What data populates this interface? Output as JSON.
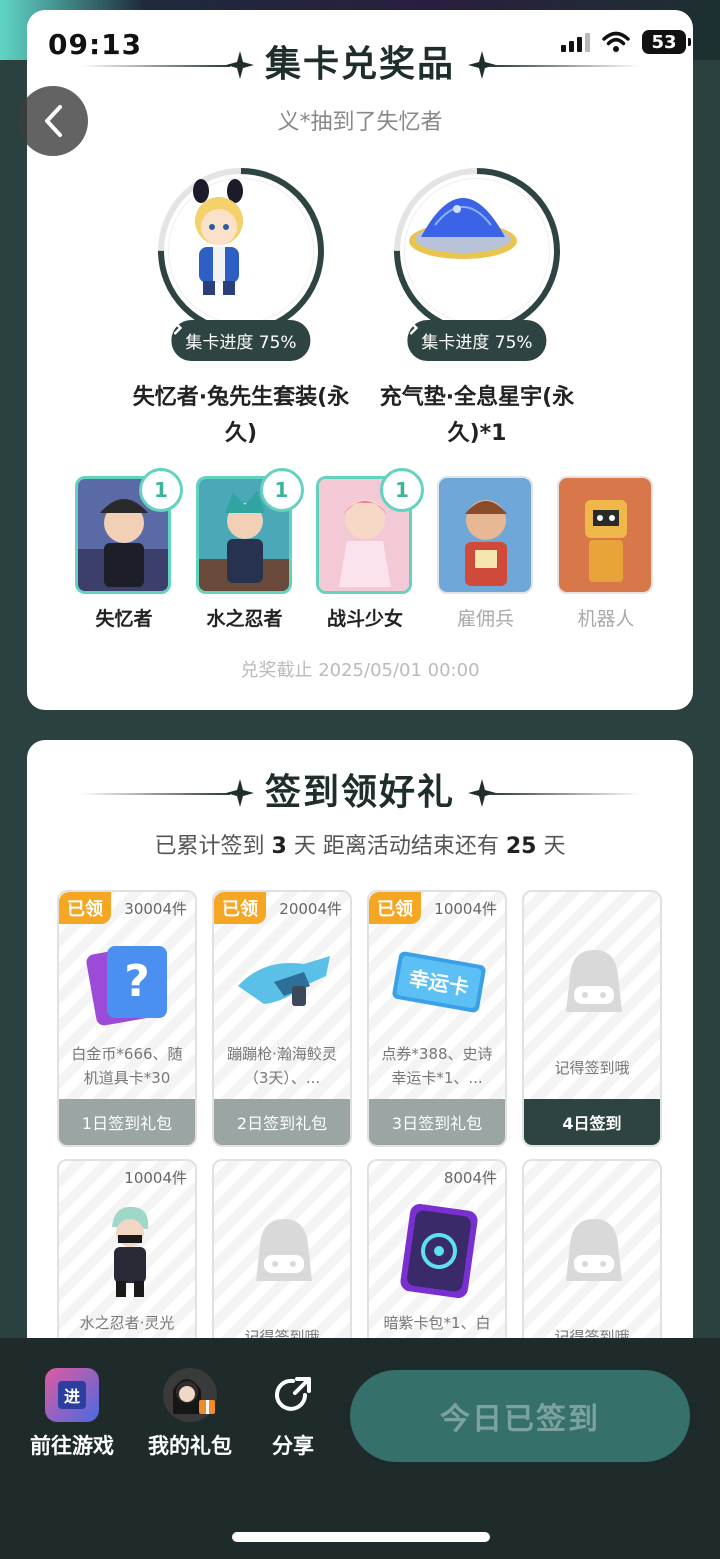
{
  "status_bar": {
    "time": "09:13",
    "battery": "53"
  },
  "card1": {
    "title": "集卡兑奖品",
    "subtitle": "义*抽到了失忆者",
    "prizes": [
      {
        "name": "失忆者·兔先生套装(永久)",
        "progress_label": "集卡进度 75%",
        "progress": 0.75,
        "icon": "character-figure-icon"
      },
      {
        "name": "充气垫·全息星宇(永久)*1",
        "progress_label": "集卡进度 75%",
        "progress": 0.75,
        "icon": "inflatable-pad-icon"
      }
    ],
    "characters": [
      {
        "name": "失忆者",
        "count": "1",
        "owned": true
      },
      {
        "name": "水之忍者",
        "count": "1",
        "owned": true
      },
      {
        "name": "战斗少女",
        "count": "1",
        "owned": true
      },
      {
        "name": "雇佣兵",
        "count": "",
        "owned": false
      },
      {
        "name": "机器人",
        "count": "",
        "owned": false
      }
    ],
    "deadline": "兑奖截止 2025/05/01 00:00"
  },
  "card2": {
    "title": "签到领好礼",
    "info_prefix": "已累计签到",
    "info_days": "3",
    "info_mid": "天 距离活动结束还有",
    "info_remaining": "25",
    "info_suffix": "天",
    "gifts": [
      {
        "tag": "已领",
        "count": "30004件",
        "desc": "白金币*666、随机道具卡*30",
        "footer": "1日签到礼包",
        "icon": "mystery-card-icon"
      },
      {
        "tag": "已领",
        "count": "20004件",
        "desc": "蹦蹦枪·瀚海鲛灵（3天）、...",
        "footer": "2日签到礼包",
        "icon": "blaster-icon"
      },
      {
        "tag": "已领",
        "count": "10004件",
        "desc": "点券*388、史诗幸运卡*1、...",
        "footer": "3日签到礼包",
        "icon": "lucky-card-icon",
        "card_text": "幸运卡"
      },
      {
        "tag": "",
        "count": "",
        "desc": "记得签到哦",
        "footer": "4日签到",
        "icon": "placeholder-mascot-icon",
        "today": true
      },
      {
        "tag": "",
        "count": "10004件",
        "desc": "水之忍者·灵光",
        "footer": "",
        "icon": "ninja-figure-icon"
      },
      {
        "tag": "",
        "count": "",
        "desc": "记得签到哦",
        "footer": "",
        "icon": "placeholder-mascot-icon"
      },
      {
        "tag": "",
        "count": "8004件",
        "desc": "暗紫卡包*1、白",
        "footer": "",
        "icon": "card-pack-icon"
      },
      {
        "tag": "",
        "count": "",
        "desc": "记得签到哦",
        "footer": "",
        "icon": "placeholder-mascot-icon"
      }
    ]
  },
  "bottom_bar": {
    "go_game": "前往游戏",
    "game_icon_text": "进",
    "my_gifts": "我的礼包",
    "share": "分享",
    "checkin_button": "今日已签到"
  }
}
